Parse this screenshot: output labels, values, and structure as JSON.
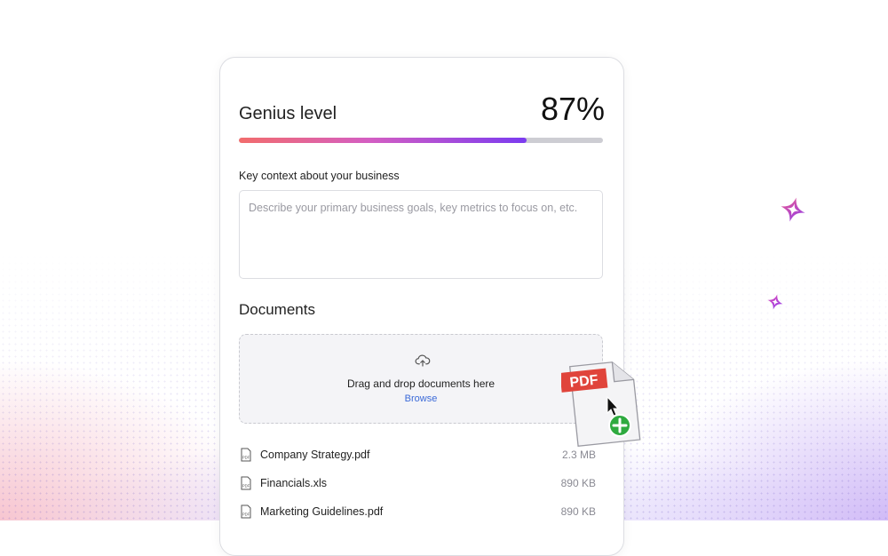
{
  "genius": {
    "title": "Genius level",
    "value_text": "87%",
    "progress": 0.79
  },
  "context": {
    "label": "Key context about your business",
    "placeholder": "Describe your primary business goals, key metrics to focus on, etc.",
    "value": ""
  },
  "documents": {
    "heading": "Documents",
    "dropzone_text": "Drag and drop documents here",
    "browse_label": "Browse",
    "files": [
      {
        "name": "Company Strategy.pdf",
        "size": "2.3 MB"
      },
      {
        "name": "Financials.xls",
        "size": "890 KB"
      },
      {
        "name": "Marketing Guidelines.pdf",
        "size": "890 KB"
      }
    ]
  },
  "file_icon_label": "PDF",
  "drag_badge_label": "PDF",
  "colors": {
    "accent_start": "#f26c6c",
    "accent_mid": "#d45ec2",
    "accent_end": "#7b3bf0",
    "link": "#3b6ad8",
    "badge_red": "#e0443b",
    "plus_green": "#2eaa3f"
  },
  "icons": [
    "upload-cloud-icon",
    "pdf-file-icon",
    "pdf-drag-file-icon",
    "cursor-icon",
    "add-plus-icon",
    "sparkle-icon"
  ]
}
